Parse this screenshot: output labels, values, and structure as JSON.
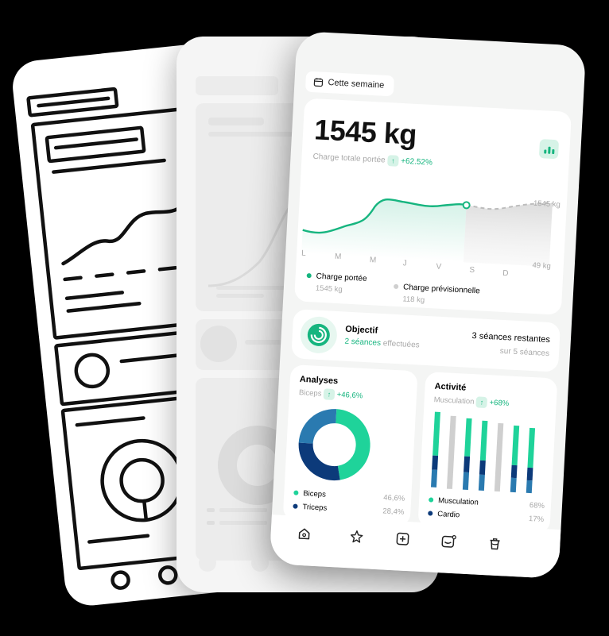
{
  "header": {
    "period_label": "Cette semaine"
  },
  "load_card": {
    "total": "1545 kg",
    "caption": "Charge totale portée",
    "change": "+62.52%",
    "max_label": "1545 kg",
    "min_label": "49 kg",
    "days": [
      "L",
      "M",
      "M",
      "J",
      "V",
      "S",
      "D"
    ],
    "legend": [
      {
        "name": "Charge portée",
        "value": "1545 kg",
        "color": "#16b57f"
      },
      {
        "name": "Charge prévisionnelle",
        "value": "118 kg",
        "color": "#cfcfcf"
      }
    ]
  },
  "goal": {
    "title": "Objectif",
    "done_count": "2 séances",
    "done_suffix": "effectuées",
    "remaining": "3 séances restantes",
    "total": "sur 5 séances"
  },
  "analyses": {
    "title": "Analyses",
    "subtitle": "Biceps",
    "change": "+46,6%",
    "legend": [
      {
        "name": "Biceps",
        "value": "46,6%",
        "color": "#1fd39a"
      },
      {
        "name": "Triceps",
        "value": "28,4%",
        "color": "#0c3a7a"
      }
    ],
    "slices": [
      {
        "name": "Biceps",
        "value": 46.6,
        "color": "#1fd39a"
      },
      {
        "name": "Triceps",
        "value": 28.4,
        "color": "#0c3a7a"
      },
      {
        "name": "",
        "value": 25.0,
        "color": "#2a7ab0"
      }
    ]
  },
  "activity": {
    "title": "Activité",
    "subtitle": "Musculation",
    "change": "+68%",
    "legend": [
      {
        "name": "Musculation",
        "value": "68%",
        "color": "#1fd39a"
      },
      {
        "name": "Cardio",
        "value": "17%",
        "color": "#0c3a7a"
      }
    ]
  },
  "nav": {
    "items": [
      "home-icon",
      "star-icon",
      "add-icon",
      "mail-icon",
      "trash-icon"
    ]
  }
}
